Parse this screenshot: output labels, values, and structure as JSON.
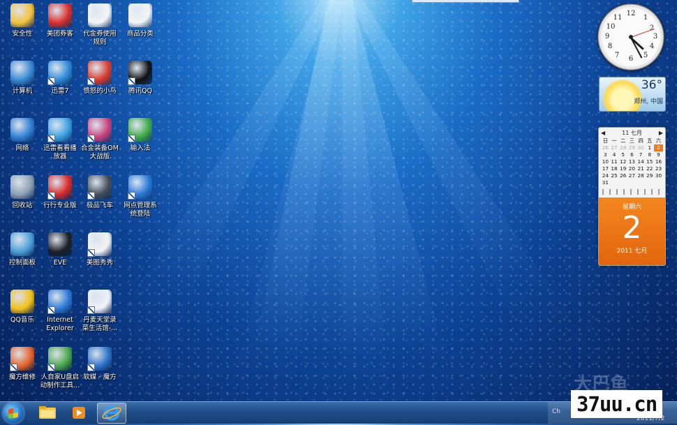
{
  "desktop": {
    "icons": [
      {
        "label": "安全性",
        "icon": "folder-icon",
        "color": "#f5c33b"
      },
      {
        "label": "美团券客",
        "icon": "meituan-icon",
        "color": "#d9302b"
      },
      {
        "label": "代金券使用\n规则",
        "icon": "document-icon",
        "color": "#f4f4f4"
      },
      {
        "label": "商品分类",
        "icon": "document-icon",
        "color": "#f4f4f4"
      },
      {
        "label": "计算机",
        "icon": "computer-icon",
        "color": "#3a8ad6"
      },
      {
        "label": "迅雷7",
        "icon": "thunder-icon",
        "color": "#2d8ad8"
      },
      {
        "label": "愤怒的小鸟",
        "icon": "angry-bird-icon",
        "color": "#d83a2b"
      },
      {
        "label": "腾讯QQ",
        "icon": "qq-penguin-icon",
        "color": "#111111"
      },
      {
        "label": "网络",
        "icon": "network-globe-icon",
        "color": "#2f7fd4"
      },
      {
        "label": "迅雷看看播\n放器",
        "icon": "xunlei-player-icon",
        "color": "#3aa0e0"
      },
      {
        "label": "合金装备OM\n大战版",
        "icon": "game-icon",
        "color": "#c7417a"
      },
      {
        "label": "输入法",
        "icon": "keyboard-icon",
        "color": "#3da945"
      },
      {
        "label": "回收站",
        "icon": "recycle-bin-icon",
        "color": "#8ea0b3"
      },
      {
        "label": "行行专业版",
        "icon": "mcafee-icon",
        "color": "#d92a28"
      },
      {
        "label": "极品飞车",
        "icon": "nfs-icon",
        "color": "#444d58"
      },
      {
        "label": "网点管理系\n统登陆",
        "icon": "ie-icon",
        "color": "#2b7ad8"
      },
      {
        "label": "控制面板",
        "icon": "control-panel-icon",
        "color": "#4b9fd8"
      },
      {
        "label": "EVE",
        "icon": "eve-icon",
        "color": "#1c1f24"
      },
      {
        "label": "美图秀秀",
        "icon": "meitu-icon",
        "color": "#f2f2f2"
      },
      {
        "label": "QQ音乐",
        "icon": "qq-music-icon",
        "color": "#f2c018"
      },
      {
        "label": "Internet\nExplorer",
        "icon": "ie-icon",
        "color": "#2b7ad8"
      },
      {
        "label": "丹麦天堂录\n菜生活馆-...",
        "icon": "ie-document-icon",
        "color": "#eef2f8"
      },
      {
        "label": "魔方维修",
        "icon": "toolbox-icon",
        "color": "#e6632a"
      },
      {
        "label": "人自家U盘启\n动制作工具...",
        "icon": "usb-tool-icon",
        "color": "#49a84b"
      },
      {
        "label": "软媒 - 魔方",
        "icon": "magic-cube-icon",
        "color": "#2d73c9"
      }
    ]
  },
  "gadgets": {
    "clock": {
      "numbers": [
        "12",
        "1",
        "2",
        "3",
        "4",
        "5",
        "6",
        "7",
        "8",
        "9",
        "10",
        "11"
      ],
      "time": "4:25"
    },
    "weather": {
      "temperature": "36°",
      "city": "郑州, 中国"
    },
    "calendar": {
      "month_label": "11 七月",
      "weekday_headers": [
        "日",
        "一",
        "二",
        "三",
        "四",
        "五",
        "六"
      ],
      "weeks": [
        [
          "26",
          "27",
          "28",
          "29",
          "30",
          "1",
          "2"
        ],
        [
          "3",
          "4",
          "5",
          "6",
          "7",
          "8",
          "9"
        ],
        [
          "10",
          "11",
          "12",
          "13",
          "14",
          "15",
          "16"
        ],
        [
          "17",
          "18",
          "19",
          "20",
          "21",
          "22",
          "23"
        ],
        [
          "24",
          "25",
          "26",
          "27",
          "28",
          "29",
          "30"
        ],
        [
          "31",
          "",
          "",
          "",
          "",
          "",
          ""
        ]
      ],
      "weekday": "星期六",
      "day": "2",
      "year_month": "2011 七月"
    }
  },
  "taskbar": {
    "buttons": [
      {
        "name": "explorer-folder-icon"
      },
      {
        "name": "media-player-icon"
      },
      {
        "name": "ie-icon"
      }
    ],
    "tray_text": "Ch",
    "clock_date": "2011/7/2"
  },
  "watermark": {
    "text": "37uu.cn",
    "faint": "大巴鱼"
  }
}
